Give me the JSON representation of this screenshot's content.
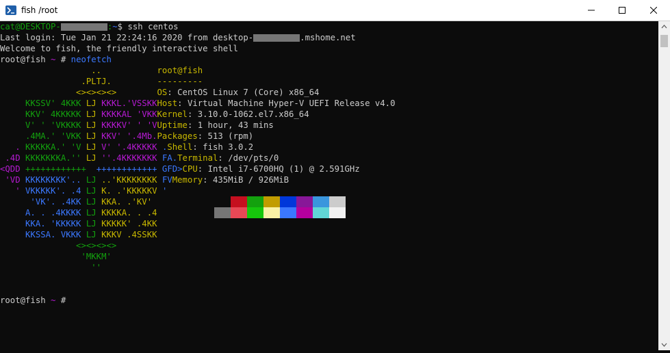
{
  "window": {
    "title": "fish /root"
  },
  "terminal": {
    "lines": [
      {
        "segments": [
          {
            "t": "cat@DESKTOP-",
            "c": "c-green"
          },
          {
            "t": "      ",
            "c": "c-blk"
          },
          {
            "t": ":",
            "c": "c-green"
          },
          {
            "t": "~",
            "c": "c-blue"
          },
          {
            "t": "$ ssh centos",
            "c": "c-white"
          }
        ]
      },
      {
        "segments": [
          {
            "t": "Last login: Tue Jan 21 22:24:16 2020 from desktop-",
            "c": "c-white"
          },
          {
            "t": "      ",
            "c": "c-blk"
          },
          {
            "t": ".mshome.net",
            "c": "c-white"
          }
        ]
      },
      {
        "segments": [
          {
            "t": "Welcome to fish, the friendly interactive shell",
            "c": "c-white"
          }
        ]
      },
      {
        "segments": [
          {
            "t": "root@fish ",
            "c": "c-white"
          },
          {
            "t": "~",
            "c": "c-mag"
          },
          {
            "t": " # ",
            "c": "c-white"
          },
          {
            "t": "neofetch",
            "c": "c-blue"
          }
        ]
      }
    ],
    "final_prompt": {
      "user": "root@fish ",
      "tilde": "~",
      "suffix": " #"
    }
  },
  "neofetch": {
    "logo": [
      [
        {
          "t": "                  ..",
          "c": "c-yel"
        }
      ],
      [
        {
          "t": "                .PLTJ.",
          "c": "c-yel"
        }
      ],
      [
        {
          "t": "               <><><><>",
          "c": "c-yel"
        }
      ],
      [
        {
          "t": "     KKSSV' 4KKK ",
          "c": "c-green"
        },
        {
          "t": "LJ",
          "c": "c-yel"
        },
        {
          "t": " KKKL.'VSSKK",
          "c": "c-mag"
        }
      ],
      [
        {
          "t": "     KKV' 4KKKKK ",
          "c": "c-green"
        },
        {
          "t": "LJ",
          "c": "c-yel"
        },
        {
          "t": " KKKKAL 'VKK",
          "c": "c-mag"
        }
      ],
      [
        {
          "t": "     V' ' 'VKKKK ",
          "c": "c-green"
        },
        {
          "t": "LJ",
          "c": "c-yel"
        },
        {
          "t": " KKKKV' ' 'V",
          "c": "c-mag"
        }
      ],
      [
        {
          "t": "     .4MA.' 'VKK ",
          "c": "c-green"
        },
        {
          "t": "LJ",
          "c": "c-yel"
        },
        {
          "t": " KKV' '.4Mb.",
          "c": "c-mag"
        }
      ],
      [
        {
          "t": "   . ",
          "c": "c-mag"
        },
        {
          "t": "KKKKKA.' 'V ",
          "c": "c-green"
        },
        {
          "t": "LJ",
          "c": "c-yel"
        },
        {
          "t": " V' '.4KKKKK ",
          "c": "c-mag"
        },
        {
          "t": ".",
          "c": "c-blue"
        }
      ],
      [
        {
          "t": " .4D ",
          "c": "c-mag"
        },
        {
          "t": "KKKKKKKA.'' ",
          "c": "c-green"
        },
        {
          "t": "LJ",
          "c": "c-yel"
        },
        {
          "t": " ''.4KKKKKKK ",
          "c": "c-mag"
        },
        {
          "t": "FA.",
          "c": "c-blue"
        }
      ],
      [
        {
          "t": "<QDD ",
          "c": "c-mag"
        },
        {
          "t": "++++++++++++  ",
          "c": "c-green"
        },
        {
          "t": "++++++++++++ GFD>",
          "c": "c-blue"
        }
      ],
      [
        {
          "t": " 'VD ",
          "c": "c-mag"
        },
        {
          "t": "KKKKKKKK'.. ",
          "c": "c-blue"
        },
        {
          "t": "LJ",
          "c": "c-green"
        },
        {
          "t": " ..'KKKKKKKK ",
          "c": "c-yel"
        },
        {
          "t": "FV",
          "c": "c-blue"
        }
      ],
      [
        {
          "t": "   ' ",
          "c": "c-mag"
        },
        {
          "t": "VKKKKK'. .4 ",
          "c": "c-blue"
        },
        {
          "t": "LJ",
          "c": "c-green"
        },
        {
          "t": " K. .'KKKKKV ",
          "c": "c-yel"
        },
        {
          "t": "'",
          "c": "c-blue"
        }
      ],
      [
        {
          "t": "      'VK'. .4KK ",
          "c": "c-blue"
        },
        {
          "t": "LJ",
          "c": "c-green"
        },
        {
          "t": " KKA. .'KV'",
          "c": "c-yel"
        }
      ],
      [
        {
          "t": "     A. . .4KKKK ",
          "c": "c-blue"
        },
        {
          "t": "LJ",
          "c": "c-green"
        },
        {
          "t": " KKKKA. . .4",
          "c": "c-yel"
        }
      ],
      [
        {
          "t": "     KKA. 'KKKKK ",
          "c": "c-blue"
        },
        {
          "t": "LJ",
          "c": "c-green"
        },
        {
          "t": " KKKKK' .4KK",
          "c": "c-yel"
        }
      ],
      [
        {
          "t": "     KKSSA. VKKK ",
          "c": "c-blue"
        },
        {
          "t": "LJ",
          "c": "c-green"
        },
        {
          "t": " KKKV .4SSKK",
          "c": "c-yel"
        }
      ],
      [
        {
          "t": "               <><><><>",
          "c": "c-green"
        }
      ],
      [
        {
          "t": "                'MKKM'",
          "c": "c-green"
        }
      ],
      [
        {
          "t": "                  ''",
          "c": "c-green"
        }
      ]
    ],
    "header": "root@fish",
    "separator": "---------",
    "info": [
      {
        "key": "OS",
        "value": "CentOS Linux 7 (Core) x86_64"
      },
      {
        "key": "Host",
        "value": "Virtual Machine Hyper-V UEFI Release v4.0"
      },
      {
        "key": "Kernel",
        "value": "3.10.0-1062.el7.x86_64"
      },
      {
        "key": "Uptime",
        "value": "1 hour, 43 mins"
      },
      {
        "key": "Packages",
        "value": "513 (rpm)"
      },
      {
        "key": "Shell",
        "value": "fish 3.0.2"
      },
      {
        "key": "Terminal",
        "value": "/dev/pts/0"
      },
      {
        "key": "CPU",
        "value": "Intel i7-6700HQ (1) @ 2.591GHz"
      },
      {
        "key": "Memory",
        "value": "435MiB / 926MiB"
      }
    ],
    "palette": [
      [
        "#0c0c0c",
        "#c50f1f",
        "#13a10e",
        "#c19c00",
        "#0037da",
        "#881798",
        "#3a96dd",
        "#cccccc"
      ],
      [
        "#767676",
        "#e74856",
        "#16c60c",
        "#f9f1a5",
        "#3b78ff",
        "#b4009e",
        "#61d6d6",
        "#f2f2f2"
      ]
    ]
  },
  "colors": {
    "info_key": "#c8b800",
    "header": "#c8b800"
  }
}
